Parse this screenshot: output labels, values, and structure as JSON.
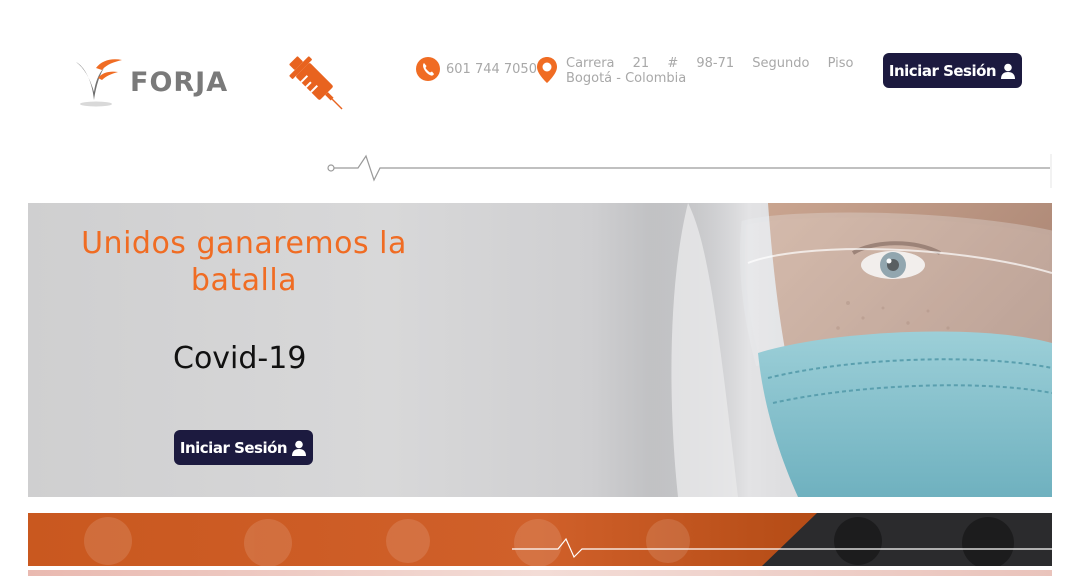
{
  "header": {
    "logo_text": "FORJA",
    "phone": "601 744 7050",
    "address_line1": "Carrera 21 # 98-71 Segundo Piso",
    "address_line2": "Bogotá - Colombia",
    "login_label": "Iniciar Sesión"
  },
  "hero": {
    "title": "Unidos ganaremos la batalla",
    "subtitle": "Covid-19",
    "login_label": "Iniciar Sesión"
  },
  "icons": {
    "phone": "phone-icon",
    "location": "map-pin-icon",
    "user": "user-icon",
    "syringe": "syringe-icon"
  },
  "colors": {
    "accent": "#f06c23",
    "button": "#1c1a3f",
    "text_muted": "#a8a8a8"
  }
}
